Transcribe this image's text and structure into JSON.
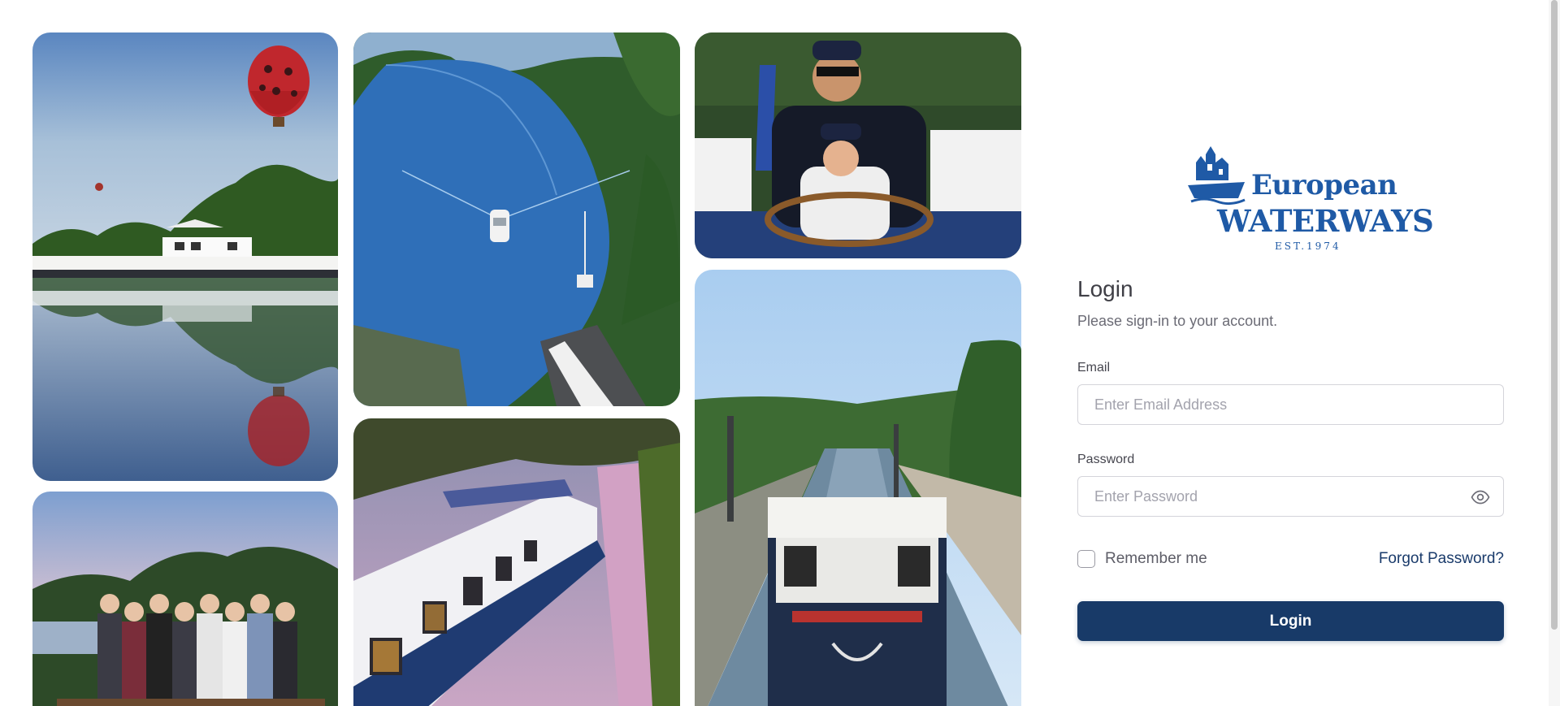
{
  "gallery": {
    "photos": [
      {
        "name": "balloon-barge-photo",
        "subject": "hot-air balloon over hotel barge reflected in river"
      },
      {
        "name": "group-dinner-photo",
        "subject": "group of guests on barge deck at sunset"
      },
      {
        "name": "aerial-river-photo",
        "subject": "aerial view of boat on river through wooded valley"
      },
      {
        "name": "barge-sunset-canal-photo",
        "subject": "white hotel barge moored on canal at dusk"
      },
      {
        "name": "captain-child-photo",
        "subject": "captain and child steering wheel"
      },
      {
        "name": "aqueduct-barge-photo",
        "subject": "barge crossing canal aqueduct bridge"
      }
    ]
  },
  "brand": {
    "line1": "European",
    "line2": "WATERWAYS",
    "established": "EST.1974",
    "color": "#1f5aa6"
  },
  "login": {
    "title": "Login",
    "subtitle": "Please sign-in to your account.",
    "email_label": "Email",
    "email_placeholder": "Enter Email Address",
    "email_value": "",
    "password_label": "Password",
    "password_placeholder": "Enter Password",
    "password_value": "",
    "remember_label": "Remember me",
    "remember_checked": false,
    "forgot_label": "Forgot Password?",
    "submit_label": "Login",
    "button_color": "#183a68"
  },
  "icons": {
    "password_toggle": "eye-icon",
    "logo_mark": "castle-ship-icon"
  }
}
